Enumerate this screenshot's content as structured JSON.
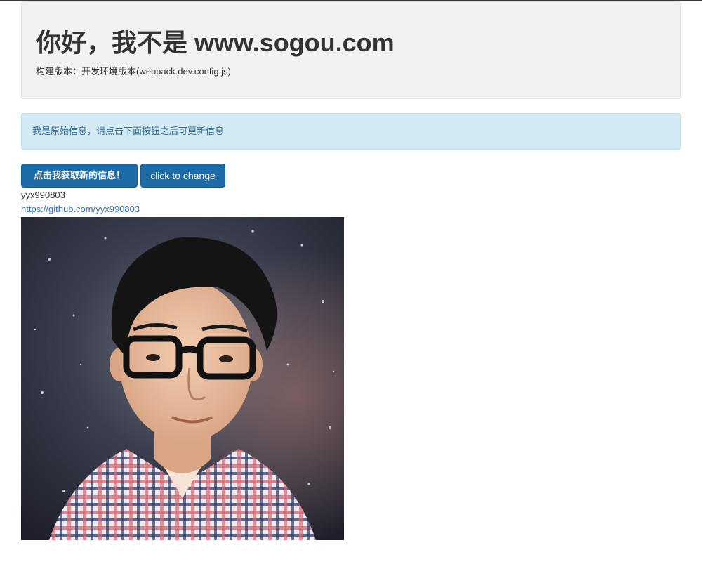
{
  "header": {
    "title": "你好，我不是 www.sogou.com",
    "build_label": "构建版本：开发环境版本(webpack.dev.config.js)"
  },
  "alert": {
    "message": "我是原始信息，请点击下面按钮之后可更新信息"
  },
  "actions": {
    "fetch_label": "点击我获取新的信息！",
    "change_label": "click to change"
  },
  "user": {
    "name": "yyx990803",
    "link": "https://github.com/yyx990803",
    "avatar_icon": "person-photo"
  },
  "colors": {
    "primary_button": "#1d6ca8",
    "alert_bg": "#d3e9f4",
    "jumbotron_bg": "#f2f2f2",
    "link": "#2b6fb3"
  }
}
